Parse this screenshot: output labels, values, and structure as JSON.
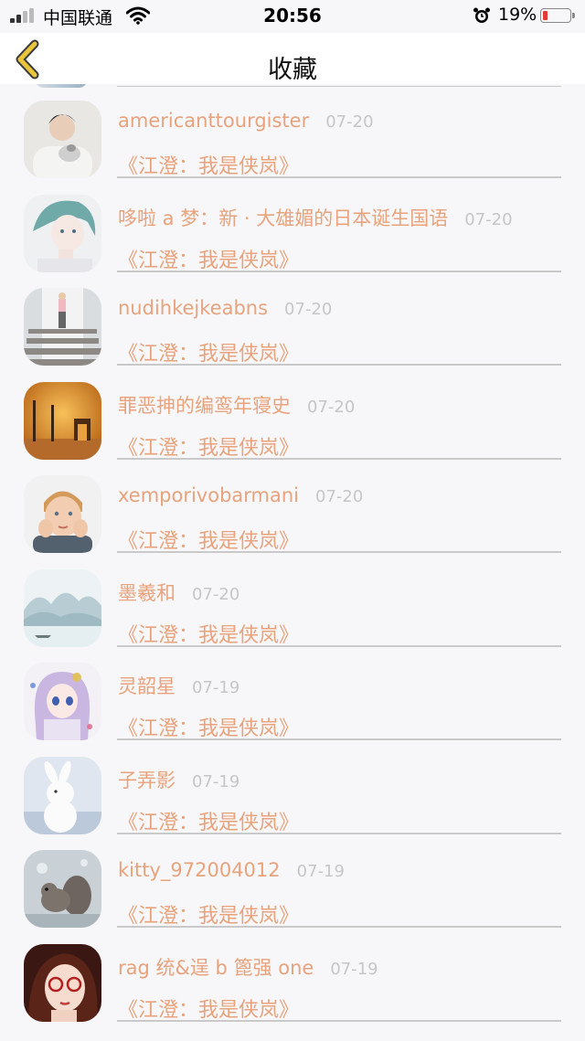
{
  "status_bar": {
    "carrier": "中国联通",
    "time": "20:56",
    "battery": "19%",
    "battery_level": 0.19,
    "signal_icon": "signal-bars-icon",
    "wifi_icon": "wifi-icon",
    "alarm_icon": "alarm-clock-icon",
    "battery_icon": "battery-icon",
    "battery_low_color": "#e53935"
  },
  "nav": {
    "title": "收藏",
    "back_icon": "chevron-left-icon",
    "back_color": "#e8c53a"
  },
  "colors": {
    "accent": "#e8a37c",
    "date": "#c6c6c6",
    "divider": "#c9c9c9"
  },
  "items": [
    {
      "name": "americanttourgister",
      "date": "07-20",
      "title": "《江澄：我是侠岚》"
    },
    {
      "name": "哆啦 a 梦：新 · 大雄媚的日本诞生国语",
      "date": "07-20",
      "title": "《江澄：我是侠岚》"
    },
    {
      "name": "nudihkejkeabns",
      "date": "07-20",
      "title": "《江澄：我是侠岚》"
    },
    {
      "name": "罪恶抻的编鸾年寝史",
      "date": "07-20",
      "title": "《江澄：我是侠岚》"
    },
    {
      "name": "xemporivobarmani",
      "date": "07-20",
      "title": "《江澄：我是侠岚》"
    },
    {
      "name": "墨羲和",
      "date": "07-20",
      "title": "《江澄：我是侠岚》"
    },
    {
      "name": "灵韶星",
      "date": "07-19",
      "title": "《江澄：我是侠岚》"
    },
    {
      "name": "子弄影",
      "date": "07-19",
      "title": "《江澄：我是侠岚》"
    },
    {
      "name": "kitty_972004012",
      "date": "07-19",
      "title": "《江澄：我是侠岚》"
    },
    {
      "name": "rag 统&逞 b 篦强 one",
      "date": "07-19",
      "title": "《江澄：我是侠岚》"
    }
  ]
}
